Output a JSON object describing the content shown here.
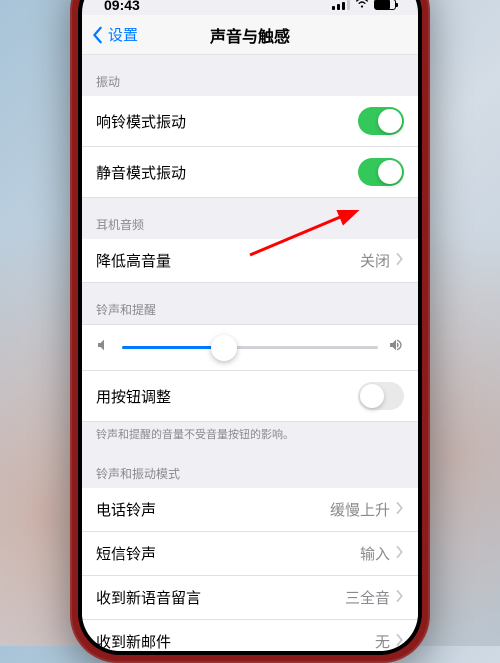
{
  "status": {
    "time": "09:43"
  },
  "nav": {
    "back": "设置",
    "title": "声音与触感"
  },
  "sections": {
    "vibration": {
      "header": "振动",
      "ring_vibrate": "响铃模式振动",
      "silent_vibrate": "静音模式振动"
    },
    "headphone": {
      "header": "耳机音频",
      "reduce_loud": "降低高音量",
      "reduce_loud_value": "关闭"
    },
    "ringer": {
      "header": "铃声和提醒",
      "button_adjust": "用按钮调整",
      "footer": "铃声和提醒的音量不受音量按钮的影响。"
    },
    "patterns": {
      "header": "铃声和振动模式",
      "ringtone": "电话铃声",
      "ringtone_value": "缓慢上升",
      "text_tone": "短信铃声",
      "text_tone_value": "输入",
      "voicemail": "收到新语音留言",
      "voicemail_value": "三全音",
      "mail": "收到新邮件",
      "mail_value": "无"
    }
  },
  "toggles": {
    "ring_vibrate": true,
    "silent_vibrate": true,
    "button_adjust": false
  },
  "slider": {
    "value": 40
  }
}
